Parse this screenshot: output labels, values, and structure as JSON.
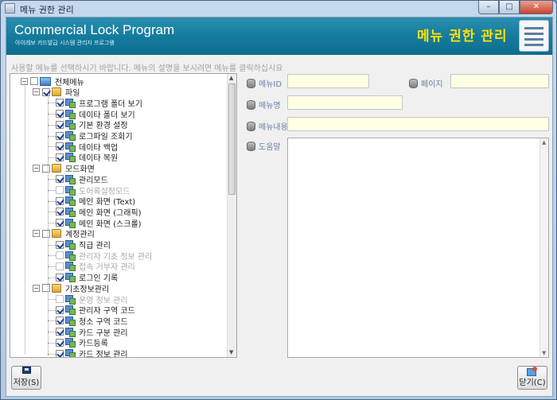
{
  "window": {
    "title": "메뉴 권한 관리",
    "controls": {
      "minimize": "–",
      "maximize": "□",
      "close": "✕"
    }
  },
  "banner": {
    "product": "Commercial Lock Program",
    "product_sub": "아이레보 카드발급 시스템 관리자 프로그램",
    "menu_title": "메뉴 권한 관리",
    "icon": "document-list-icon"
  },
  "instruction": "사용할 메뉴를 선택하시기 바랍니다. 메뉴의 설명을 보시려면 메뉴를 클릭하십시요",
  "tree": {
    "root": {
      "label": "전체메뉴",
      "checked": false
    },
    "nodes": [
      {
        "label": "파일",
        "level": 1,
        "checked": true,
        "disabled": false
      },
      {
        "label": "프로그램 폴더 보기",
        "level": 2,
        "checked": true,
        "disabled": false
      },
      {
        "label": "데이타 폴더 보기",
        "level": 2,
        "checked": true,
        "disabled": false
      },
      {
        "label": "기본 환경 설정",
        "level": 2,
        "checked": true,
        "disabled": false
      },
      {
        "label": "로그파일 조회기",
        "level": 2,
        "checked": true,
        "disabled": false
      },
      {
        "label": "데이타 백업",
        "level": 2,
        "checked": true,
        "disabled": false
      },
      {
        "label": "데이타 복원",
        "level": 2,
        "checked": true,
        "disabled": false
      },
      {
        "label": "모드화면",
        "level": 1,
        "checked": false,
        "disabled": false
      },
      {
        "label": "관리모드",
        "level": 2,
        "checked": true,
        "disabled": false
      },
      {
        "label": "도어록설정모드",
        "level": 2,
        "checked": false,
        "disabled": true
      },
      {
        "label": "메인 화면 (Text)",
        "level": 2,
        "checked": true,
        "disabled": false
      },
      {
        "label": "메인 화면 (그래픽)",
        "level": 2,
        "checked": true,
        "disabled": false
      },
      {
        "label": "메인 화면 (스크롤)",
        "level": 2,
        "checked": true,
        "disabled": false
      },
      {
        "label": "계정관리",
        "level": 1,
        "checked": false,
        "disabled": false
      },
      {
        "label": "직급 관리",
        "level": 2,
        "checked": true,
        "disabled": false
      },
      {
        "label": "관리자 기초 정보 관리",
        "level": 2,
        "checked": false,
        "disabled": true
      },
      {
        "label": "접속 거부자 관리",
        "level": 2,
        "checked": false,
        "disabled": true
      },
      {
        "label": "로그인 기록",
        "level": 2,
        "checked": true,
        "disabled": false
      },
      {
        "label": "기초정보관리",
        "level": 1,
        "checked": false,
        "disabled": false
      },
      {
        "label": "운영 정보 관리",
        "level": 2,
        "checked": false,
        "disabled": true
      },
      {
        "label": "관리자 구역 코드",
        "level": 2,
        "checked": true,
        "disabled": false
      },
      {
        "label": "청소 구역 코드",
        "level": 2,
        "checked": true,
        "disabled": false
      },
      {
        "label": "카드 구분 관리",
        "level": 2,
        "checked": true,
        "disabled": false
      },
      {
        "label": "카드등록",
        "level": 2,
        "checked": true,
        "disabled": false
      },
      {
        "label": "카드 정보 관리",
        "level": 2,
        "checked": true,
        "disabled": false
      }
    ]
  },
  "form": {
    "menu_id": {
      "label": "메뉴ID",
      "value": ""
    },
    "page": {
      "label": "페이지",
      "value": ""
    },
    "menu_name": {
      "label": "메뉴명",
      "value": ""
    },
    "menu_content": {
      "label": "메뉴내용",
      "value": ""
    },
    "help": {
      "label": "도움말",
      "value": ""
    }
  },
  "buttons": {
    "save": "저장(S)",
    "close": "닫기(C)"
  }
}
